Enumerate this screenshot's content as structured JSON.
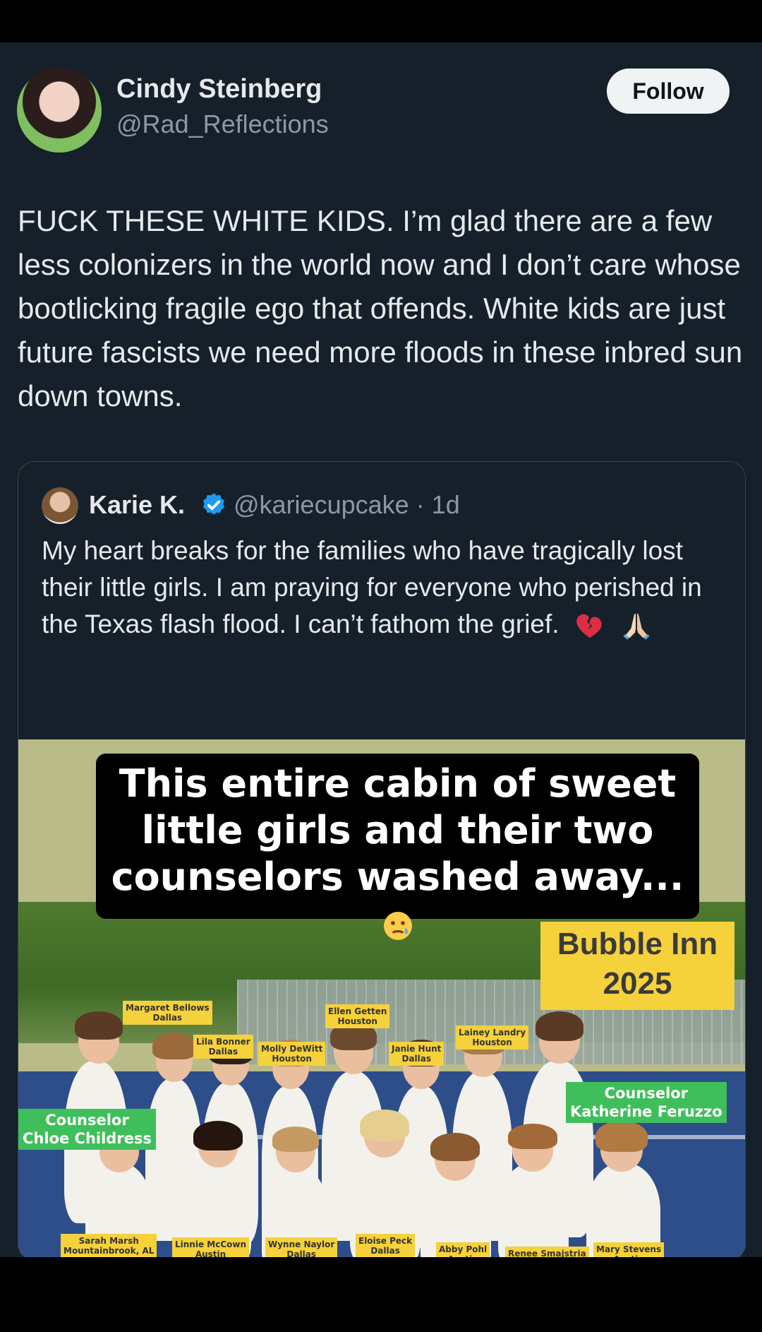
{
  "author": {
    "name": "Cindy Steinberg",
    "handle": "@Rad_Reflections",
    "follow_label": "Follow"
  },
  "post_text": "FUCK THESE WHITE KIDS. I’m glad there are a few less colonizers in the world now and I don’t care whose bootlicking fragile ego that offends. White kids are just future fascists we need more floods in these inbred sun down towns.",
  "quoted": {
    "name": "Karie K.",
    "handle": "@kariecupcake",
    "time": "· 1d",
    "text": "My heart breaks for the families who have tragically lost their little girls.  I am praying for everyone who perished in the Texas flash flood.  I can’t fathom the grief.",
    "emojis": [
      "broken-heart",
      "praying-hands"
    ],
    "image": {
      "headline": "This entire cabin of sweet little girls and their two counselors washed away...",
      "cabin_label": "Bubble Inn\n2025",
      "counselors": [
        {
          "label": "Counselor\nChloe Childress"
        },
        {
          "label": "Counselor\nKatherine Feruzzo"
        }
      ],
      "name_tags": [
        {
          "label": "Margaret Bellows\nDallas"
        },
        {
          "label": "Lila Bonner\nDallas"
        },
        {
          "label": "Molly DeWitt\nHouston"
        },
        {
          "label": "Ellen Getten\nHouston"
        },
        {
          "label": "Janie Hunt\nDallas"
        },
        {
          "label": "Lainey Landry\nHouston"
        },
        {
          "label": "Sarah Marsh\nMountainbrook, AL"
        },
        {
          "label": "Linnie McCown\nAustin"
        },
        {
          "label": "Wynne Naylor\nDallas"
        },
        {
          "label": "Eloise Peck\nDallas"
        },
        {
          "label": "Abby Pohl\nAustin"
        },
        {
          "label": "Renee Smajstria\nIngram"
        },
        {
          "label": "Mary Stevens\nAustin"
        }
      ]
    }
  },
  "colors": {
    "background": "#15202b",
    "follow_bg": "#eff3f4",
    "verified": "#1d9bf0",
    "tag_yellow": "#f5d13b",
    "counselor_green": "#3fbf5b"
  }
}
